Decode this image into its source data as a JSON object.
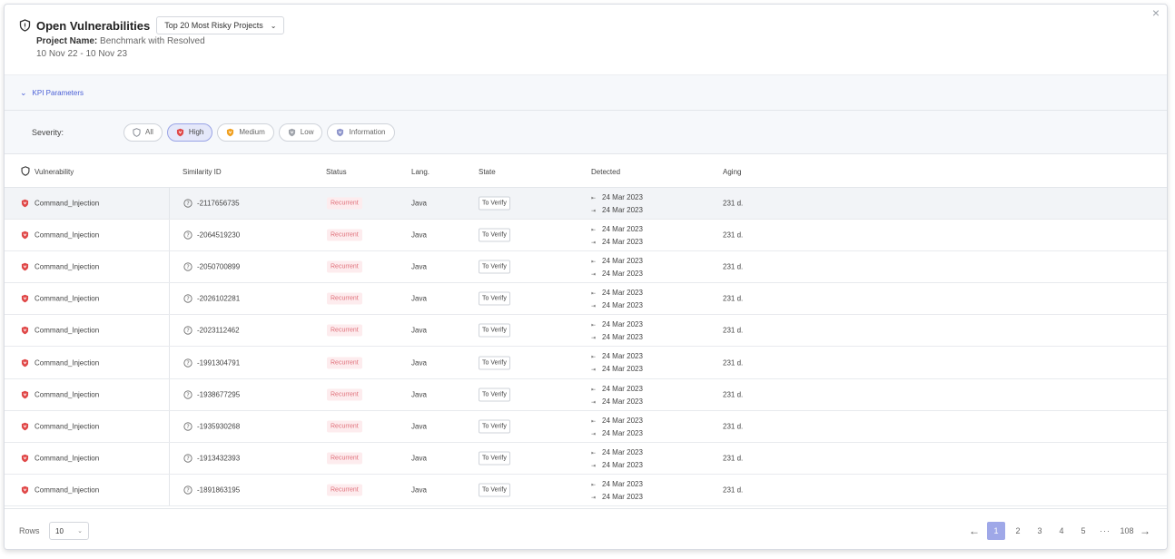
{
  "header": {
    "title": "Open Vulnerabilities",
    "dropdown_label": "Top 20 Most Risky Projects",
    "project_label": "Project Name:",
    "project_value": "Benchmark with Resolved",
    "date_range": "10 Nov 22 - 10 Nov 23",
    "close_glyph": "×"
  },
  "kpi": {
    "label": "KPI Parameters"
  },
  "severity": {
    "label": "Severity:",
    "chips": [
      {
        "label": "All",
        "color": "#8a8f98",
        "active": false
      },
      {
        "label": "High",
        "color": "#e04848",
        "active": true
      },
      {
        "label": "Medium",
        "color": "#f0a020",
        "active": false
      },
      {
        "label": "Low",
        "color": "#a0a4ab",
        "active": false
      },
      {
        "label": "Information",
        "color": "#8f96cc",
        "active": false
      }
    ]
  },
  "table": {
    "columns": {
      "vulnerability": "Vulnerability",
      "similarity_id": "Similarity ID",
      "status": "Status",
      "lang": "Lang.",
      "state": "State",
      "detected": "Detected",
      "aging": "Aging"
    },
    "rows": [
      {
        "vulnerability": "Command_Injection",
        "similarity_id": "-2117656735",
        "status": "Recurrent",
        "lang": "Java",
        "state": "To Verify",
        "first_detected": "24 Mar 2023",
        "last_detected": "24 Mar 2023",
        "aging": "231 d."
      },
      {
        "vulnerability": "Command_Injection",
        "similarity_id": "-2064519230",
        "status": "Recurrent",
        "lang": "Java",
        "state": "To Verify",
        "first_detected": "24 Mar 2023",
        "last_detected": "24 Mar 2023",
        "aging": "231 d."
      },
      {
        "vulnerability": "Command_Injection",
        "similarity_id": "-2050700899",
        "status": "Recurrent",
        "lang": "Java",
        "state": "To Verify",
        "first_detected": "24 Mar 2023",
        "last_detected": "24 Mar 2023",
        "aging": "231 d."
      },
      {
        "vulnerability": "Command_Injection",
        "similarity_id": "-2026102281",
        "status": "Recurrent",
        "lang": "Java",
        "state": "To Verify",
        "first_detected": "24 Mar 2023",
        "last_detected": "24 Mar 2023",
        "aging": "231 d."
      },
      {
        "vulnerability": "Command_Injection",
        "similarity_id": "-2023112462",
        "status": "Recurrent",
        "lang": "Java",
        "state": "To Verify",
        "first_detected": "24 Mar 2023",
        "last_detected": "24 Mar 2023",
        "aging": "231 d."
      },
      {
        "vulnerability": "Command_Injection",
        "similarity_id": "-1991304791",
        "status": "Recurrent",
        "lang": "Java",
        "state": "To Verify",
        "first_detected": "24 Mar 2023",
        "last_detected": "24 Mar 2023",
        "aging": "231 d."
      },
      {
        "vulnerability": "Command_Injection",
        "similarity_id": "-1938677295",
        "status": "Recurrent",
        "lang": "Java",
        "state": "To Verify",
        "first_detected": "24 Mar 2023",
        "last_detected": "24 Mar 2023",
        "aging": "231 d."
      },
      {
        "vulnerability": "Command_Injection",
        "similarity_id": "-1935930268",
        "status": "Recurrent",
        "lang": "Java",
        "state": "To Verify",
        "first_detected": "24 Mar 2023",
        "last_detected": "24 Mar 2023",
        "aging": "231 d."
      },
      {
        "vulnerability": "Command_Injection",
        "similarity_id": "-1913432393",
        "status": "Recurrent",
        "lang": "Java",
        "state": "To Verify",
        "first_detected": "24 Mar 2023",
        "last_detected": "24 Mar 2023",
        "aging": "231 d."
      },
      {
        "vulnerability": "Command_Injection",
        "similarity_id": "-1891863195",
        "status": "Recurrent",
        "lang": "Java",
        "state": "To Verify",
        "first_detected": "24 Mar 2023",
        "last_detected": "24 Mar 2023",
        "aging": "231 d."
      }
    ]
  },
  "footer": {
    "rows_label": "Rows",
    "rows_value": "10",
    "pages": [
      "1",
      "2",
      "3",
      "4",
      "5"
    ],
    "current_page": "1",
    "ellipsis": "···",
    "last_page": "108"
  },
  "colors": {
    "accent": "#4a5fd6",
    "high": "#e04848",
    "recurrent_bg": "#fdecee",
    "recurrent_text": "#e0707a"
  }
}
